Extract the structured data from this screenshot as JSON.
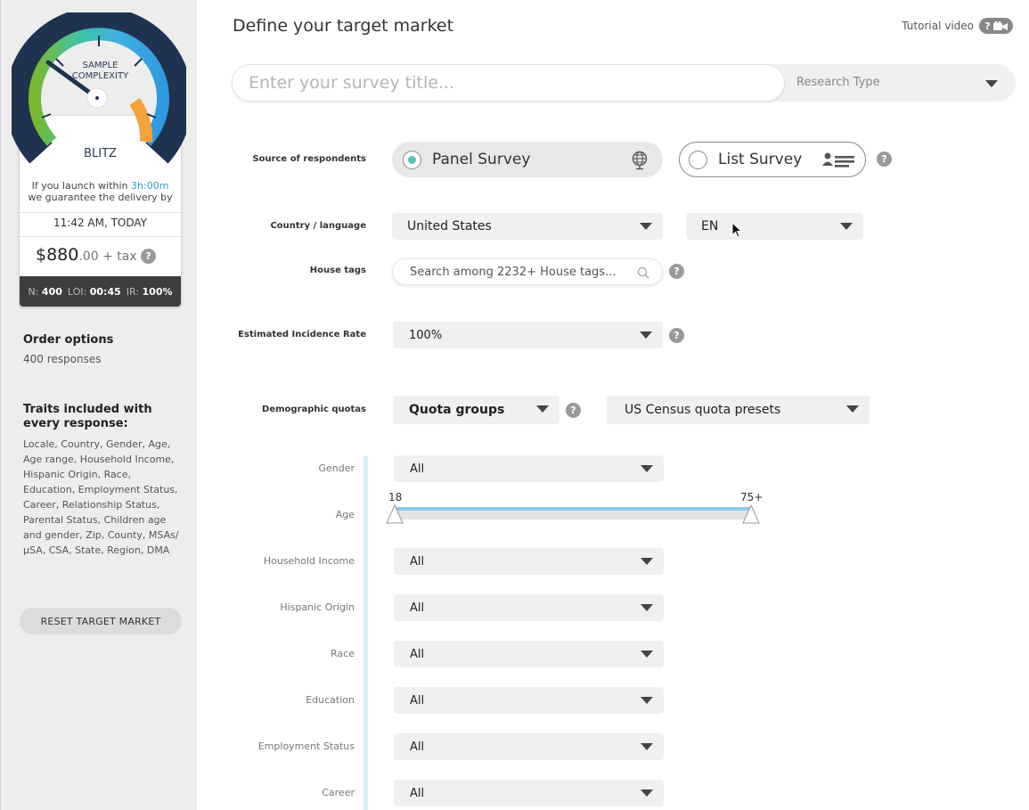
{
  "sidebar": {
    "gauge": {
      "label_line1": "SAMPLE",
      "label_line2": "COMPLEXITY",
      "speed": "BLITZ",
      "level": 0.3
    },
    "launch_prefix": "If you launch within ",
    "launch_time": "3h:00m",
    "launch_suffix": "we guarantee the delivery by",
    "deadline": "11:42 AM, TODAY",
    "price_main": "$880",
    "price_cents": ".00 + tax",
    "stats": {
      "n_label": "N:",
      "n_value": "400",
      "loi_label": "LOI:",
      "loi_value": "00:45",
      "ir_label": "IR:",
      "ir_value": "100%"
    },
    "order_title": "Order options",
    "order_sub": "400 responses",
    "traits_title": "Traits included with every response:",
    "traits_list": "Locale, Country, Gender, Age, Age range, Household Income, Hispanic Origin, Race, Education, Employment Status, Career, Relationship Status, Parental Status, Children age and gender, Zip, County, MSAs/μSA, CSA, State, Region, DMA",
    "reset_label": "RESET TARGET MARKET"
  },
  "main": {
    "title": "Define your target market",
    "tutorial_label": "Tutorial video",
    "tutorial_badge": "?",
    "survey_title_placeholder": "Enter your survey title...",
    "research_type": "Research Type",
    "source_label": "Source of respondents",
    "panel_survey": "Panel Survey",
    "list_survey": "List Survey",
    "country_label": "Country / language",
    "country_value": "United States",
    "language_value": "EN",
    "house_tags_label": "House tags",
    "house_tags_placeholder": "Search among 2232+ House tags...",
    "incidence_label": "Estimated Incidence Rate",
    "incidence_value": "100%",
    "quotas_label": "Demographic quotas",
    "quota_groups": "Quota groups",
    "census_presets": "US Census quota presets",
    "gender_label": "Gender",
    "gender_value": "All",
    "age_label": "Age",
    "age_min": "18",
    "age_max": "75+",
    "household_label": "Household Income",
    "household_value": "All",
    "hispanic_label": "Hispanic Origin",
    "hispanic_value": "All",
    "race_label": "Race",
    "race_value": "All",
    "education_label": "Education",
    "education_value": "All",
    "employment_label": "Employment Status",
    "employment_value": "All",
    "career_label": "Career",
    "career_value": "All",
    "help_glyph": "?"
  },
  "colors": {
    "accent": "#2aa3c9",
    "radio_on": "#5fc1b0",
    "gauge_dark": "#1f3350"
  }
}
